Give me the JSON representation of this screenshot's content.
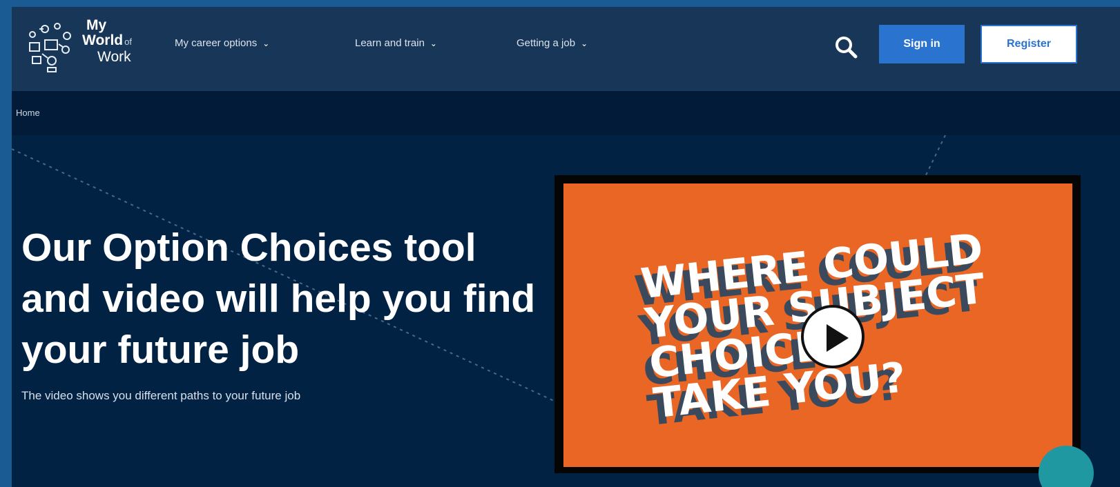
{
  "header": {
    "logo_lines": [
      "My",
      "World",
      "of",
      "Work"
    ],
    "nav": [
      {
        "label": "My career options"
      },
      {
        "label": "Learn and train"
      },
      {
        "label": "Getting a job"
      }
    ],
    "search_icon": "search-icon",
    "signin_label": "Sign in",
    "register_label": "Register"
  },
  "breadcrumb": {
    "label": "Home"
  },
  "hero": {
    "title": "Our Option Choices tool and video will help you find your future job",
    "subtitle": "The video shows you different paths to your future job"
  },
  "video": {
    "caption_lines": [
      "WHERE COULD",
      "YOUR SUBJECT",
      "CHOICES",
      "TAKE YOU?"
    ],
    "play_icon": "play-icon",
    "colors": {
      "background": "#e96625",
      "text": "#ffffff",
      "shadow": "#3a4a5c"
    }
  },
  "colors": {
    "page_bg": "#022244",
    "header_bg": "#183657",
    "accent": "#2a73cf"
  }
}
